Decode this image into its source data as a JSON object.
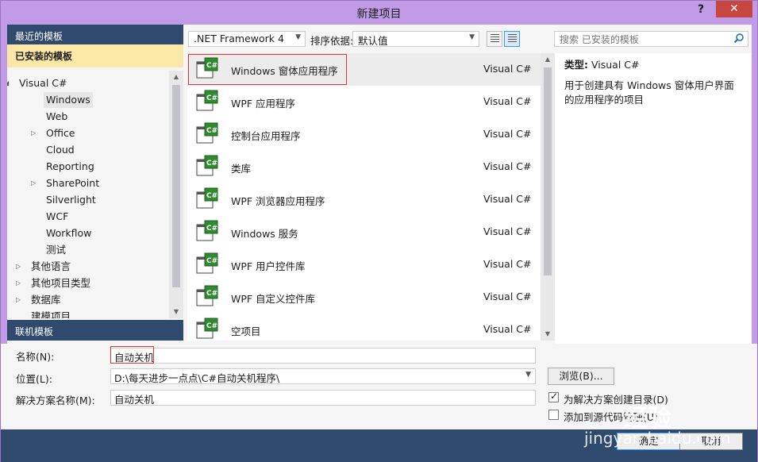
{
  "window": {
    "title": "新建项目",
    "help": "?",
    "close": "✕"
  },
  "left": {
    "recent": "最近的模板",
    "installed": "已安装的模板",
    "online": "联机模板",
    "tree": [
      {
        "label": "Visual C#",
        "arrow": "◢"
      },
      {
        "label": "Windows",
        "arrow": ""
      },
      {
        "label": "Web",
        "arrow": ""
      },
      {
        "label": "Office",
        "arrow": "▷"
      },
      {
        "label": "Cloud",
        "arrow": ""
      },
      {
        "label": "Reporting",
        "arrow": ""
      },
      {
        "label": "SharePoint",
        "arrow": "▷"
      },
      {
        "label": "Silverlight",
        "arrow": ""
      },
      {
        "label": "WCF",
        "arrow": ""
      },
      {
        "label": "Workflow",
        "arrow": ""
      },
      {
        "label": "测试",
        "arrow": ""
      },
      {
        "label": "其他语言",
        "arrow": "▷"
      },
      {
        "label": "其他项目类型",
        "arrow": "▷"
      },
      {
        "label": "数据库",
        "arrow": "▷"
      },
      {
        "label": "建模项目",
        "arrow": ""
      }
    ]
  },
  "toolbar": {
    "framework": ".NET Framework 4",
    "sort_label": "排序依据:",
    "sort_value": "默认值"
  },
  "templates": [
    {
      "name": "Windows 窗体应用程序",
      "lang": "Visual C#"
    },
    {
      "name": "WPF 应用程序",
      "lang": "Visual C#"
    },
    {
      "name": "控制台应用程序",
      "lang": "Visual C#"
    },
    {
      "name": "类库",
      "lang": "Visual C#"
    },
    {
      "name": "WPF 浏览器应用程序",
      "lang": "Visual C#"
    },
    {
      "name": "Windows 服务",
      "lang": "Visual C#"
    },
    {
      "name": "WPF 用户控件库",
      "lang": "Visual C#"
    },
    {
      "name": "WPF 自定义控件库",
      "lang": "Visual C#"
    },
    {
      "name": "空项目",
      "lang": "Visual C#"
    }
  ],
  "search": {
    "placeholder": "搜索 已安装的模板"
  },
  "details": {
    "type_label": "类型:",
    "type_value": "Visual C#",
    "description": "用于创建具有 Windows 窗体用户界面的应用程序的项目"
  },
  "form": {
    "name_label": "名称(N):",
    "name_value": "自动关机",
    "location_label": "位置(L):",
    "location_value": "D:\\每天进步一点点\\C#自动关机程序\\",
    "solution_label": "解决方案名称(M):",
    "solution_value": "自动关机",
    "browse": "浏览(B)...",
    "chk1": "为解决方案创建目录(D)",
    "chk2": "添加到源代码管理(U)"
  },
  "buttons": {
    "ok": "确定",
    "cancel": "取消"
  },
  "watermark": {
    "line1": "经验",
    "line2": "jingyan.baidu.com"
  }
}
